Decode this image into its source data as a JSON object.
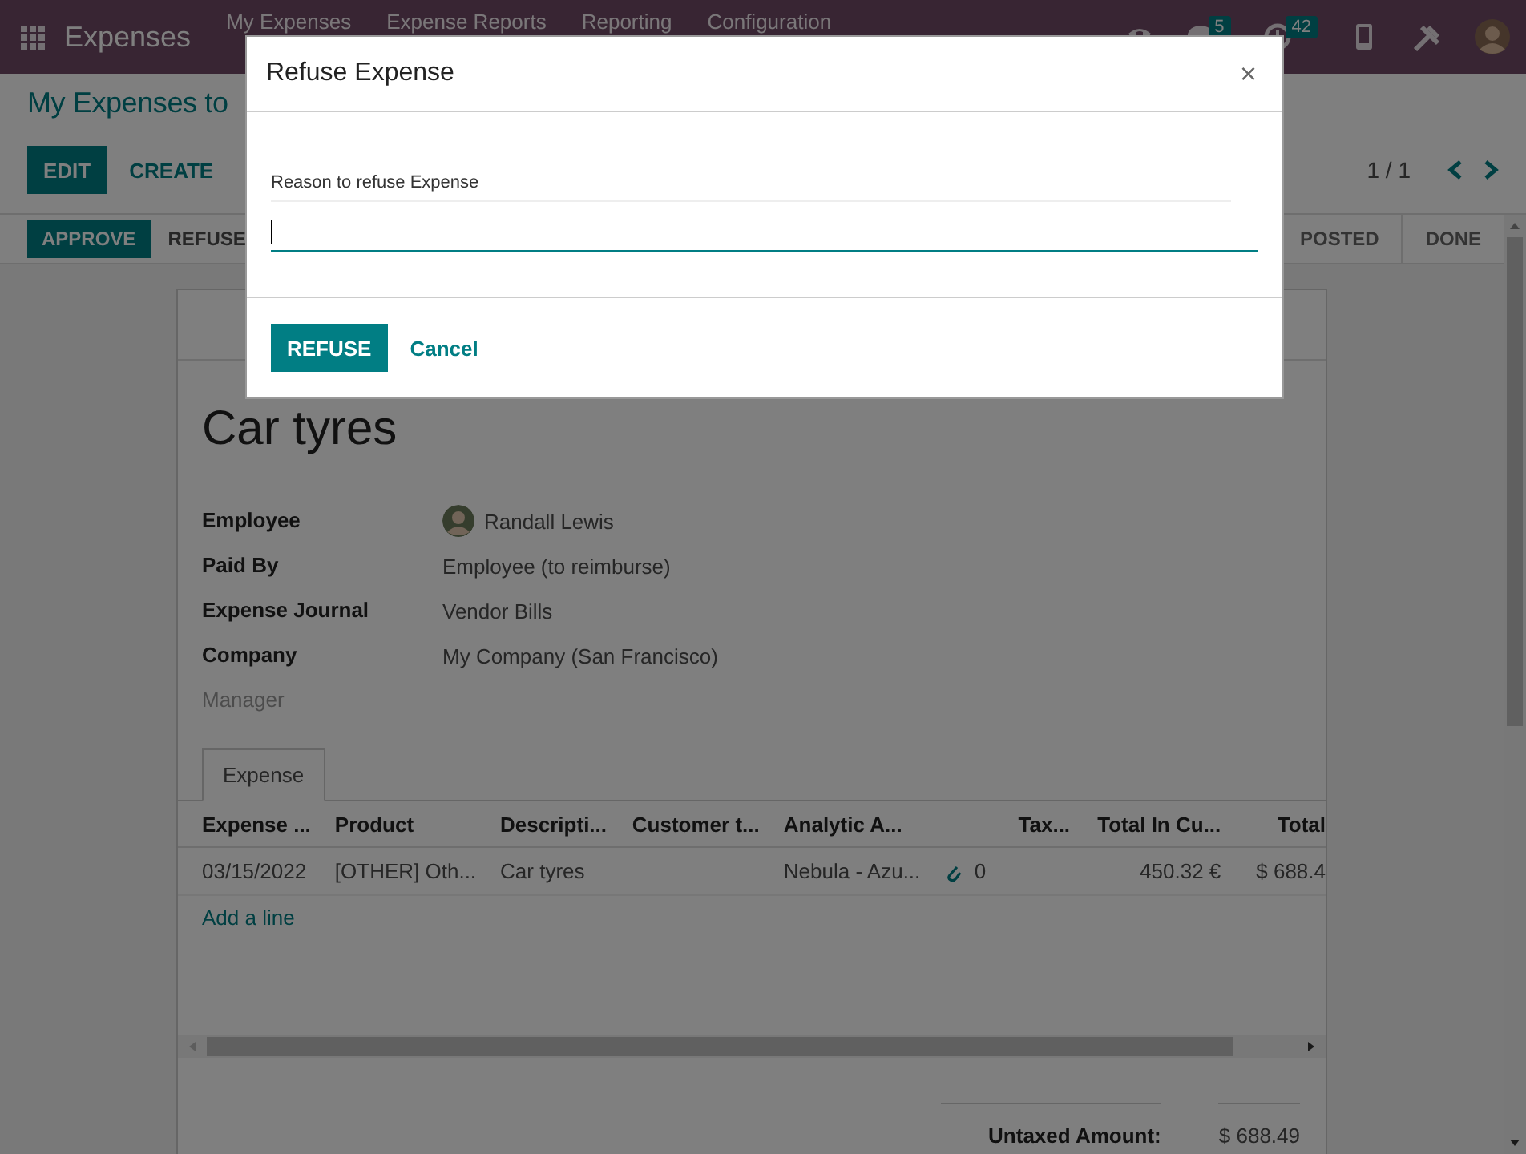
{
  "navbar": {
    "app_name": "Expenses",
    "menu": [
      {
        "label": "My Expenses"
      },
      {
        "label": "Expense Reports"
      },
      {
        "label": "Reporting"
      },
      {
        "label": "Configuration"
      }
    ],
    "systray": [
      {
        "kind": "phone"
      },
      {
        "kind": "chat",
        "badge": "5"
      },
      {
        "kind": "activity",
        "badge": "42"
      },
      {
        "kind": "device"
      },
      {
        "kind": "tools"
      },
      {
        "kind": "avatar"
      }
    ]
  },
  "control_panel": {
    "breadcrumb": "My Expenses to",
    "buttons": [
      "EDIT",
      "CREATE"
    ],
    "pager": "1 / 1"
  },
  "statusbar": {
    "buttons": [
      {
        "label": "APPROVE",
        "primary": true
      },
      {
        "label": "REFUSE",
        "primary": false
      }
    ],
    "stages": [
      "POSTED",
      "DONE"
    ]
  },
  "form": {
    "title": "Car tyres",
    "fields": [
      {
        "label": "Employee",
        "value": "Randall Lewis",
        "avatar": true
      },
      {
        "label": "Paid By",
        "value": "Employee (to reimburse)",
        "avatar": false
      },
      {
        "label": "Expense Journal",
        "value": "Vendor Bills",
        "avatar": false
      },
      {
        "label": "Company",
        "value": "My Company (San Francisco)",
        "avatar": false
      },
      {
        "label": "Manager",
        "avatar": false
      }
    ],
    "tabs": [
      {
        "label": "Expense",
        "selected": true
      }
    ],
    "table": {
      "columns": [
        {
          "label": "Expense ..."
        },
        {
          "label": "Product"
        },
        {
          "label": "Descripti..."
        },
        {
          "label": "Customer t..."
        },
        {
          "label": "Analytic A..."
        },
        {},
        {
          "label": "Tax..."
        },
        {
          "label": "Total In Cu..."
        },
        {
          "label": "Total"
        }
      ],
      "rows": [
        [
          "03/15/2022",
          "[OTHER] Oth...",
          "Car tyres",
          "",
          "Nebula - Azu...",
          "0",
          "",
          "450.32 €",
          "$ 688.4"
        ]
      ],
      "add_line": "Add a line"
    },
    "totals": [
      {
        "label": "Untaxed Amount:",
        "value": "$ 688.49"
      }
    ]
  },
  "dialog": {
    "title": "Refuse Expense",
    "close": "×",
    "field_label": "Reason to refuse Expense",
    "buttons": [
      {
        "label": "REFUSE",
        "primary": true
      },
      {
        "label": "Cancel",
        "primary": false
      }
    ]
  }
}
